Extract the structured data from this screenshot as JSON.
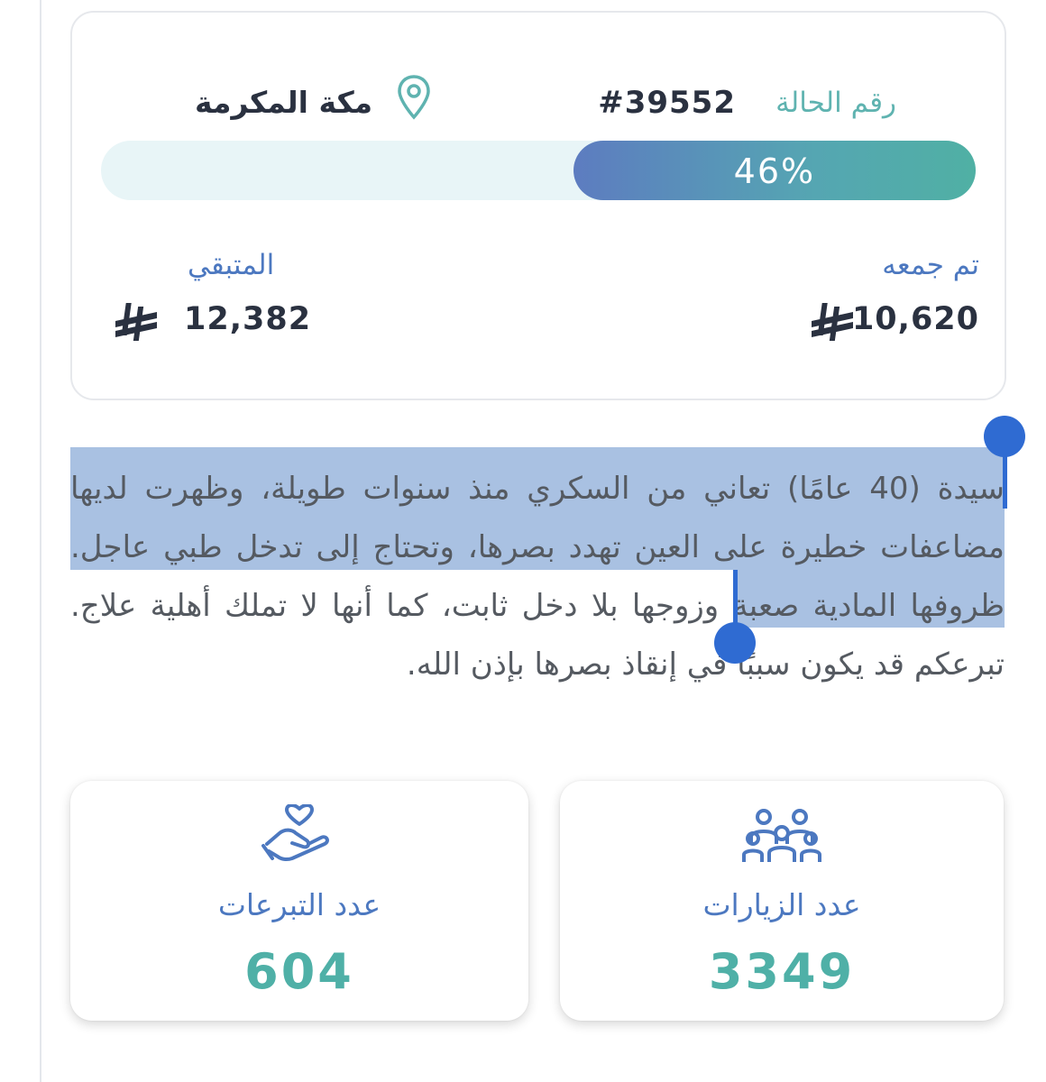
{
  "case": {
    "label": "رقم الحالة",
    "number": "#39552",
    "city": "مكة المكرمة",
    "progress": 46,
    "progress_text": "46%",
    "collected_label": "تم جمعه",
    "collected_amount": "10,620",
    "remaining_label": "المتبقي",
    "remaining_amount": "12,382",
    "currency_icon": "riyal-icon",
    "location_icon": "map-pin-icon"
  },
  "description": "سيدة (40 عامًا) تعاني من السكري منذ سنوات طويلة، وظهرت لديها مضاعفات خطيرة على العين تهدد بصرها، وتحتاج إلى تدخل طبي عاجل. ظروفها المادية صعبة وزوجها بلا دخل ثابت، كما أنها لا تملك أهلية علاج. تبرعكم قد يكون سببًا في إنقاذ بصرها بإذن الله.",
  "stats": {
    "visits": {
      "label": "عدد الزيارات",
      "value": "3349",
      "icon": "people-group-icon"
    },
    "donations": {
      "label": "عدد التبرعات",
      "value": "604",
      "icon": "hand-heart-icon"
    }
  },
  "colors": {
    "accent_teal": "#4fb0a7",
    "accent_blue": "#4c78c0",
    "selection": "#a9c1e2",
    "selection_handle": "#2f6bd2"
  }
}
